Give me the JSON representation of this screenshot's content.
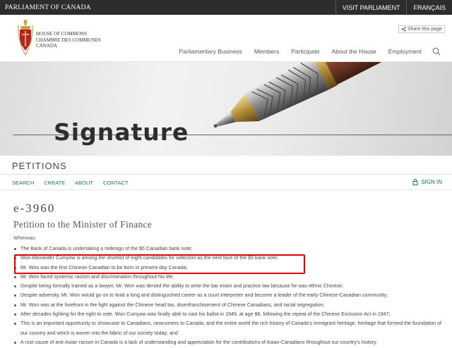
{
  "topbar": {
    "parliament": "PARLIAMENT OF CANADA",
    "visit": "VISIT PARLIAMENT",
    "language": "FRANÇAIS"
  },
  "header": {
    "org_line1": "HOUSE OF COMMONS",
    "org_line2": "CHAMBRE DES COMMUNES",
    "org_line3": "CANADA",
    "share": "Share this page",
    "nav": [
      "Parliamentary Business",
      "Members",
      "Participate",
      "About the House",
      "Employment"
    ]
  },
  "hero": {
    "text": "Signature"
  },
  "section": {
    "title": "PETITIONS",
    "links": [
      "SEARCH",
      "CREATE",
      "ABOUT",
      "CONTACT"
    ],
    "signin": "SIGN IN"
  },
  "petition": {
    "number": "e-3960",
    "title": "Petition to the Minister of Finance",
    "whereas": "Whereas:",
    "items": [
      "The Bank of Canada is undertaking a redesign of the $5 Canadian bank note;",
      "Won Alexander Cumyow is among the shortlist of eight candidates for selection as the next face of the $5 bank note;",
      "Mr. Won was the first Chinese-Canadian to be born in present-day Canada;",
      "Mr. Won faced systemic racism and discrimination throughout his life;",
      "Despite being formally trained as a lawyer, Mr. Won was denied the ability to write the bar exam and practice law because he was ethnic Chinese;",
      "Despite adversity, Mr. Won would go on to lead a long and distinguished career as a court interpreter and become a leader of the early Chinese-Canadian community;",
      "Mr. Won was at the forefront in the fight against the Chinese head tax, disenfranchisement of Chinese Canadians, and racial segregation;",
      "After decades fighting for the right to vote, Won Cumyow was finally able to cast his ballot in 1949, at age 88, following the repeal of the Chinese Exclusion Act in 1947;",
      "This is an important opportunity to showcase to Canadians, newcomers to Canada, and the entire world the rich history of Canada's immigrant heritage, heritage that formed the foundation of our country and which is woven into the fabric of our society today; and",
      "A root cause of anti-Asian racism in Canada is a lack of understanding and appreciation for the contributions of Asian-Canadians throughout our country's history."
    ]
  },
  "colors": {
    "highlight": "#e00000",
    "link": "#1f6f6a",
    "topbar": "#2d2d2d"
  }
}
